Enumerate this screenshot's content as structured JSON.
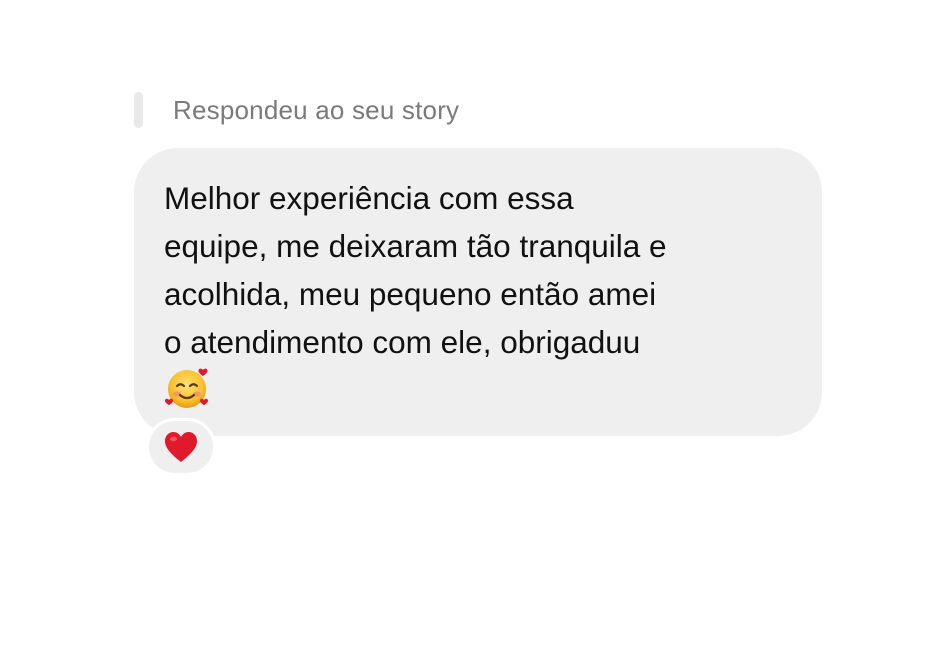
{
  "reply": {
    "label": "Respondeu ao seu story"
  },
  "message": {
    "text": "Melhor experiência com essa\nequipe, me deixaram tão tranquila e\nacolhida, meu pequeno então amei\no atendimento com ele, obrigaduu",
    "emoji": "smiling-face-with-hearts",
    "bubble_color": "#efefef",
    "text_color": "#111111"
  },
  "reaction": {
    "emoji": "red-heart",
    "color": "#e0192c"
  }
}
